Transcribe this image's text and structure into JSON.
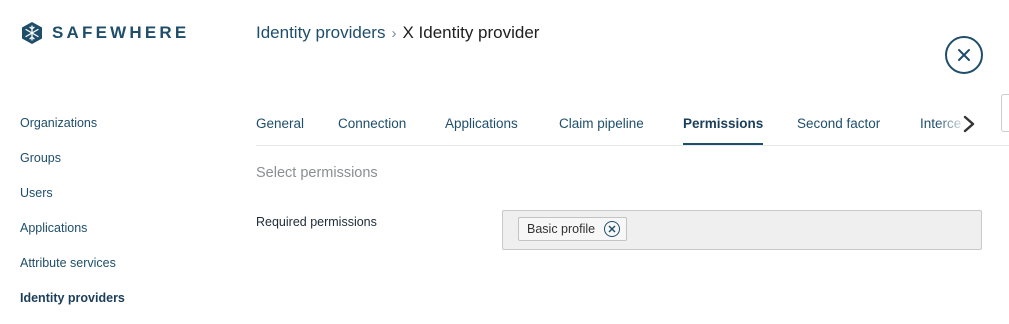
{
  "brand": {
    "name": "SAFEWHERE",
    "logo_icon": "snowflake-hexagon-icon",
    "color": "#1f4e6b"
  },
  "sidebar": {
    "items": [
      {
        "label": "Organizations",
        "active": false
      },
      {
        "label": "Groups",
        "active": false
      },
      {
        "label": "Users",
        "active": false
      },
      {
        "label": "Applications",
        "active": false
      },
      {
        "label": "Attribute services",
        "active": false
      },
      {
        "label": "Identity providers",
        "active": true
      }
    ]
  },
  "breadcrumb": {
    "parent": "Identity providers",
    "separator": "›",
    "current": "X Identity provider"
  },
  "close_icon": "close-circle-icon",
  "tabs": [
    {
      "label": "General",
      "active": false
    },
    {
      "label": "Connection",
      "active": false
    },
    {
      "label": "Applications",
      "active": false
    },
    {
      "label": "Claim pipeline",
      "active": false
    },
    {
      "label": "Permissions",
      "active": true
    },
    {
      "label": "Second factor",
      "active": false
    },
    {
      "label": "Interce",
      "active": false
    }
  ],
  "tabs_scroll_icon": "chevron-right-icon",
  "permissions": {
    "section_title": "Select permissions",
    "required_label": "Required permissions",
    "selected": [
      {
        "label": "Basic profile",
        "remove_icon": "remove-circle-icon"
      }
    ]
  }
}
